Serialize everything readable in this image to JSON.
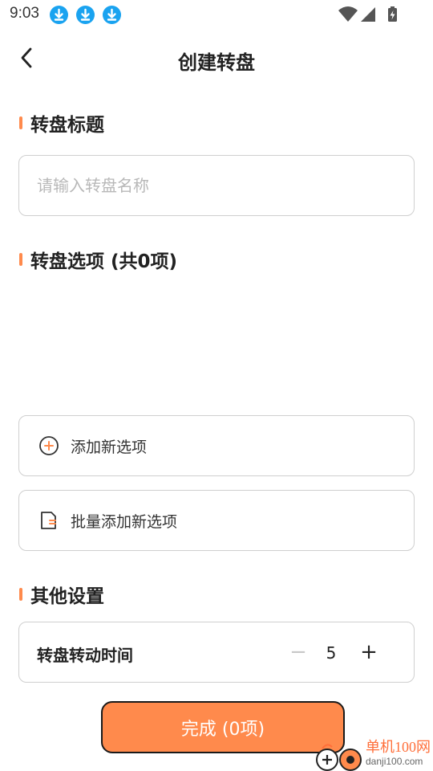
{
  "status_bar": {
    "time": "9:03",
    "notification_icons": [
      "download-icon",
      "download-icon",
      "download-icon"
    ],
    "system_icons": [
      "wifi-icon",
      "signal-icon",
      "battery-charging-icon"
    ]
  },
  "header": {
    "back_icon": "chevron-left-icon",
    "title": "创建转盘"
  },
  "title_section": {
    "heading": "转盘标题",
    "input_placeholder": "请输入转盘名称",
    "input_value": ""
  },
  "options_section": {
    "heading": "转盘选项 (共0项)",
    "items": [],
    "add_option_label": "添加新选项",
    "add_option_icon": "plus-circle-icon",
    "batch_add_label": "批量添加新选项",
    "batch_add_icon": "document-icon"
  },
  "other_section": {
    "heading": "其他设置",
    "spin_time_label": "转盘转动时间",
    "spin_time_value": "5",
    "minus_label": "−",
    "plus_label": "+"
  },
  "footer": {
    "finish_label": "完成 (0项)"
  },
  "watermark": {
    "name": "单机100网",
    "url": "danji100.com"
  },
  "colors": {
    "accent": "#ff8a4c",
    "download_badge": "#1aa3f0",
    "border": "#cfcfcf",
    "placeholder": "#b8b8b8"
  }
}
